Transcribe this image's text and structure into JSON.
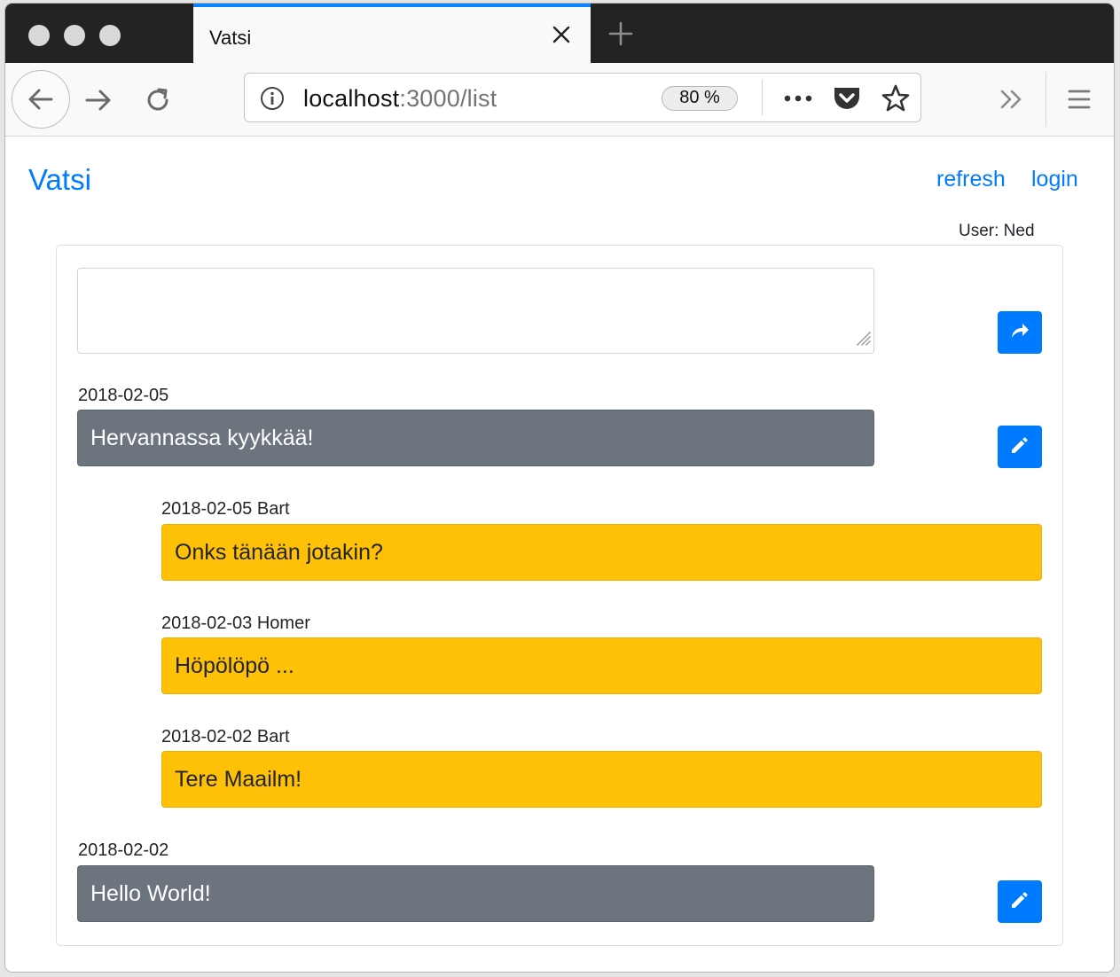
{
  "browser": {
    "tab_title": "Vatsi",
    "url_host": "localhost",
    "url_rest": ":3000/list",
    "zoom": "80 %",
    "icons": [
      "back-icon",
      "forward-icon",
      "reload-icon",
      "info-icon",
      "more-icon",
      "pocket-icon",
      "star-icon",
      "overflow-icon",
      "menu-icon",
      "close-icon",
      "plus-icon"
    ]
  },
  "app": {
    "brand": "Vatsi",
    "nav": {
      "refresh": "refresh",
      "login": "login"
    },
    "user_label": "User: Ned"
  },
  "compose": {
    "placeholder": ""
  },
  "threads": [
    {
      "meta": "2018-02-05",
      "text": "Hervannassa kyykkää!",
      "replies": [
        {
          "meta": "2018-02-05 Bart",
          "text": "Onks tänään jotakin?"
        },
        {
          "meta": "2018-02-03 Homer",
          "text": "Höpölöpö ..."
        },
        {
          "meta": "2018-02-02 Bart",
          "text": "Tere Maailm!"
        }
      ]
    },
    {
      "meta": "2018-02-02",
      "text": "Hello World!",
      "replies": []
    }
  ],
  "colors": {
    "primary": "#007bff",
    "secondary": "#6c757d",
    "warning": "#ffc107"
  }
}
